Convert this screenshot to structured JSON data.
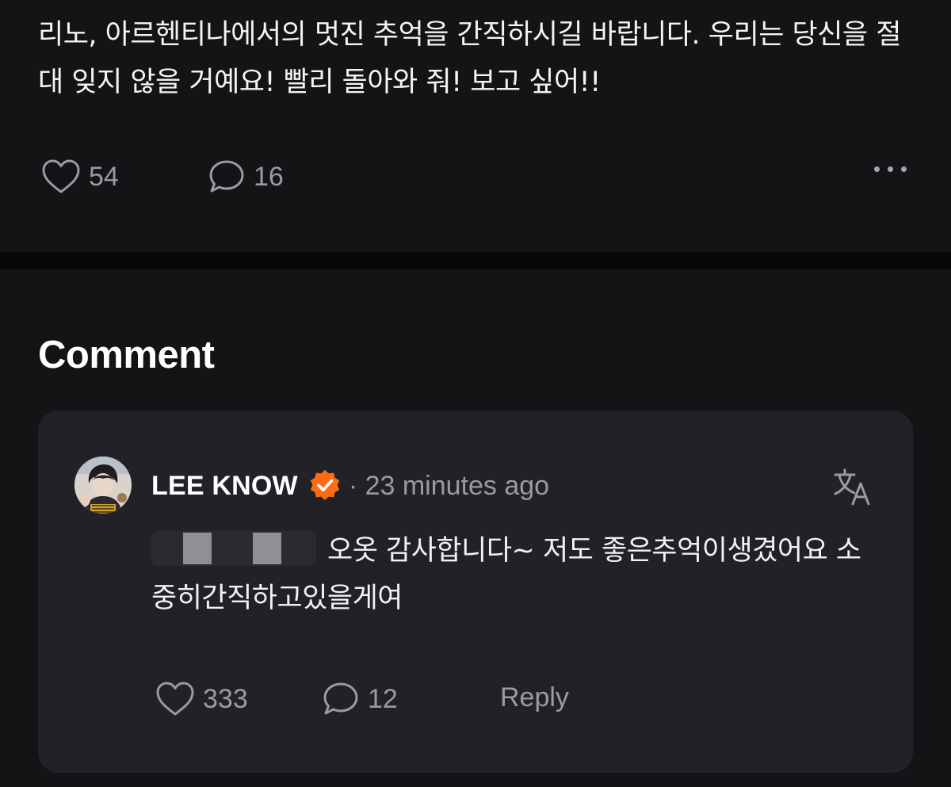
{
  "post": {
    "text": "리노, 아르헨티나에서의 멋진 추억을 간직하시길 바랍니다. 우리는 당신을 절대 잊지 않을 거예요! 빨리 돌아와 줘! 보고 싶어!!",
    "like_count": "54",
    "comment_count": "16",
    "like_icon": "heart-outline",
    "comment_icon": "speech-bubble-outline",
    "more_icon": "horizontal-ellipsis"
  },
  "comment_section": {
    "title": "Comment",
    "comment": {
      "author": "LEE KNOW",
      "verified_badge_color": "#ff6a13",
      "meta": "· 23 minutes ago",
      "translate_icon": "translate",
      "body": "오옷 감사합니다~ 저도 좋은추억이생겼어요 소중히간직하고있을게여",
      "like_count": "333",
      "reply_count": "12",
      "reply_label": "Reply"
    }
  },
  "colors": {
    "background": "#141417",
    "divider": "#070708",
    "card": "#212127",
    "muted_text": "#9a9aa2",
    "accent": "#ff6a13"
  }
}
